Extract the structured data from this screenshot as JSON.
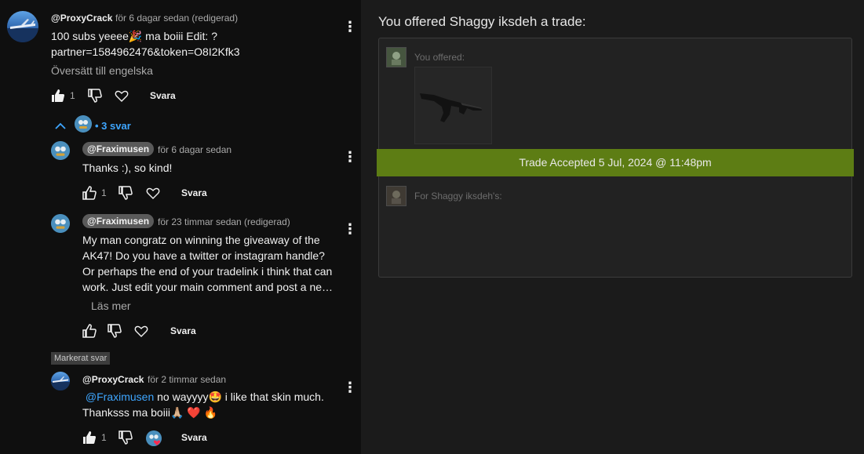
{
  "comment": {
    "author": "@ProxyCrack",
    "meta": "för 6 dagar sedan (redigerad)",
    "text_line1": "100 subs yeeee🎉 ma boiii Edit: ?",
    "text_line2": "partner=1584962476&token=O8I2Kfk3",
    "translate": "Översätt till engelska",
    "likes": "1",
    "reply_label": "Svara"
  },
  "replies_toggle": "• 3 svar",
  "replies": [
    {
      "author": "@Fraximusen",
      "meta": "för 6 dagar sedan",
      "text": "Thanks :), so kind!",
      "likes": "1",
      "reply_label": "Svara"
    },
    {
      "author": "@Fraximusen",
      "meta": "för 23 timmar sedan (redigerad)",
      "lines": [
        "My man congratz on winning the giveaway of the",
        "AK47!  Do you have a twitter or instagram handle?",
        "Or perhaps the end of your tradelink i think that can",
        "work. Just edit your main comment and post a ne…"
      ],
      "read_more": "Läs mer",
      "reply_label": "Svara"
    },
    {
      "badge": "Markerat svar",
      "author": "@ProxyCrack",
      "meta": "för 2 timmar sedan",
      "mention": "@Fraximusen",
      "text_after_mention": " no wayyyy🤩  i like that skin much.",
      "line2": "Thanksss ma boiii🙏🏼 ❤️ 🔥",
      "likes": "1",
      "reply_label": "Svara"
    }
  ],
  "trade": {
    "title": "You offered Shaggy iksdeh a trade:",
    "you_offered": "You offered:",
    "accepted": "Trade Accepted 5 Jul, 2024 @ 11:48pm",
    "for_label": "For Shaggy iksdeh's:"
  },
  "colors": {
    "accent_link": "#3ea6ff",
    "accepted_bar": "#5d7d14"
  }
}
